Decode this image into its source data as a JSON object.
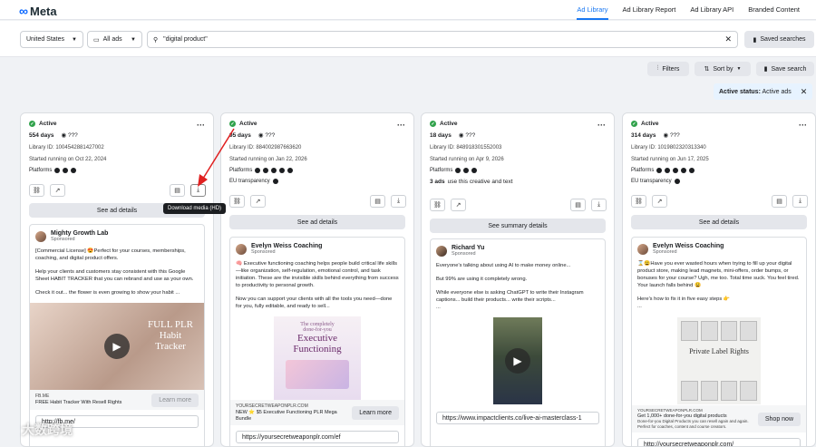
{
  "header": {
    "logo_text": "Meta",
    "nav": [
      "Ad Library",
      "Ad Library Report",
      "Ad Library API",
      "Branded Content"
    ]
  },
  "search": {
    "country": "United States",
    "ad_type": "All ads",
    "query": "\"digital product\"",
    "saved_label": "Saved searches"
  },
  "toolbar": {
    "filters": "Filters",
    "sort": "Sort by",
    "save_search": "Save search",
    "status_label": "Active status:",
    "status_value": "Active ads"
  },
  "tooltip": "Download media (HD)",
  "cards": [
    {
      "status": "Active",
      "days": "554 days",
      "views": "???",
      "library_id": "Library ID: 1004542881427002",
      "started": "Started running on Oct 22, 2024",
      "platforms_label": "Platforms",
      "button": "See ad details",
      "advertiser": "Mighty Growth Lab",
      "sponsored": "Sponsored",
      "body": [
        "[Commercial License] 😍Perfect for your courses, memberships, coaching, and digital product offers.",
        "Help your clients and customers stay consistent with this Google Sheet HABIT TRACKER that you can rebrand and use as your own.",
        "Check it out... the flower is even growing to show your habit ..."
      ],
      "cta_domain": "FB.ME",
      "cta_title": "FREE Habit Tracker With Resell Rights",
      "cta_button": "Learn more",
      "url": "http://fb.me/"
    },
    {
      "status": "Active",
      "days": "95 days",
      "views": "???",
      "library_id": "Library ID: 884002987663620",
      "started": "Started running on Jan 22, 2026",
      "platforms_label": "Platforms",
      "eu": "EU transparency",
      "button": "See ad details",
      "advertiser": "Evelyn Weiss Coaching",
      "sponsored": "Sponsored",
      "body": [
        "🧠 Executive functioning coaching helps people build critical life skills—like organization, self-regulation, emotional control, and task initiation. These are the invisible skills behind everything from success to productivity to personal growth.",
        "Now you can support your clients with all the tools you need—done for you, fully editable, and ready to sell..."
      ],
      "cta_domain": "YOURSECRETWEAPONPLR.COM",
      "cta_title": "NEW ⭐ $5 Executive Functioning PLR Mega Bundle",
      "cta_button": "Learn more",
      "url": "https://yoursecretweaponplr.com/ef",
      "media_text": [
        "The completely",
        "done-for-you",
        "Executive",
        "Functioning"
      ]
    },
    {
      "status": "Active",
      "days": "18 days",
      "views": "???",
      "library_id": "Library ID: 848918301552003",
      "started": "Started running on Apr 9, 2026",
      "platforms_label": "Platforms",
      "ads_count": "3 ads",
      "ads_count_rest": "use this creative and text",
      "button": "See summary details",
      "advertiser": "Richard Yu",
      "sponsored": "Sponsored",
      "body": [
        "Everyone's talking about using AI to make money online...",
        "But 99% are using it completely wrong.",
        "While everyone else is asking ChatGPT to write their Instagram captions... build their products... write their scripts...",
        "..."
      ],
      "url": "https://www.impactclients.co/live-ai-masterclass-1"
    },
    {
      "status": "Active",
      "days": "314 days",
      "views": "???",
      "library_id": "Library ID: 1019802320313340",
      "started": "Started running on Jun 17, 2025",
      "platforms_label": "Platforms",
      "eu": "EU transparency",
      "button": "See ad details",
      "advertiser": "Evelyn Weiss Coaching",
      "sponsored": "Sponsored",
      "body": [
        "⌛😩Have you ever wasted hours when trying to fill up your digital product store, making lead magnets, mini-offers, order bumps, or bonuses for your course? Ugh, me too. Total time suck. You feel tired. Your launch falls behind 😩",
        "Here's how to fix it in five easy steps 👉",
        "..."
      ],
      "cta_domain": "YOURSECRETWEAPONPLR.COM",
      "cta_title": "Get 1,000+ done-for-you digital products",
      "cta_sub": "Done-for-you Digital Products you can resell again and again. Perfect for coaches, content and course creators.",
      "cta_button": "Shop now",
      "url": "http://yoursecretweaponplr.com/",
      "media_text": "Private Label Rights"
    }
  ],
  "watermark": "大数跨境"
}
